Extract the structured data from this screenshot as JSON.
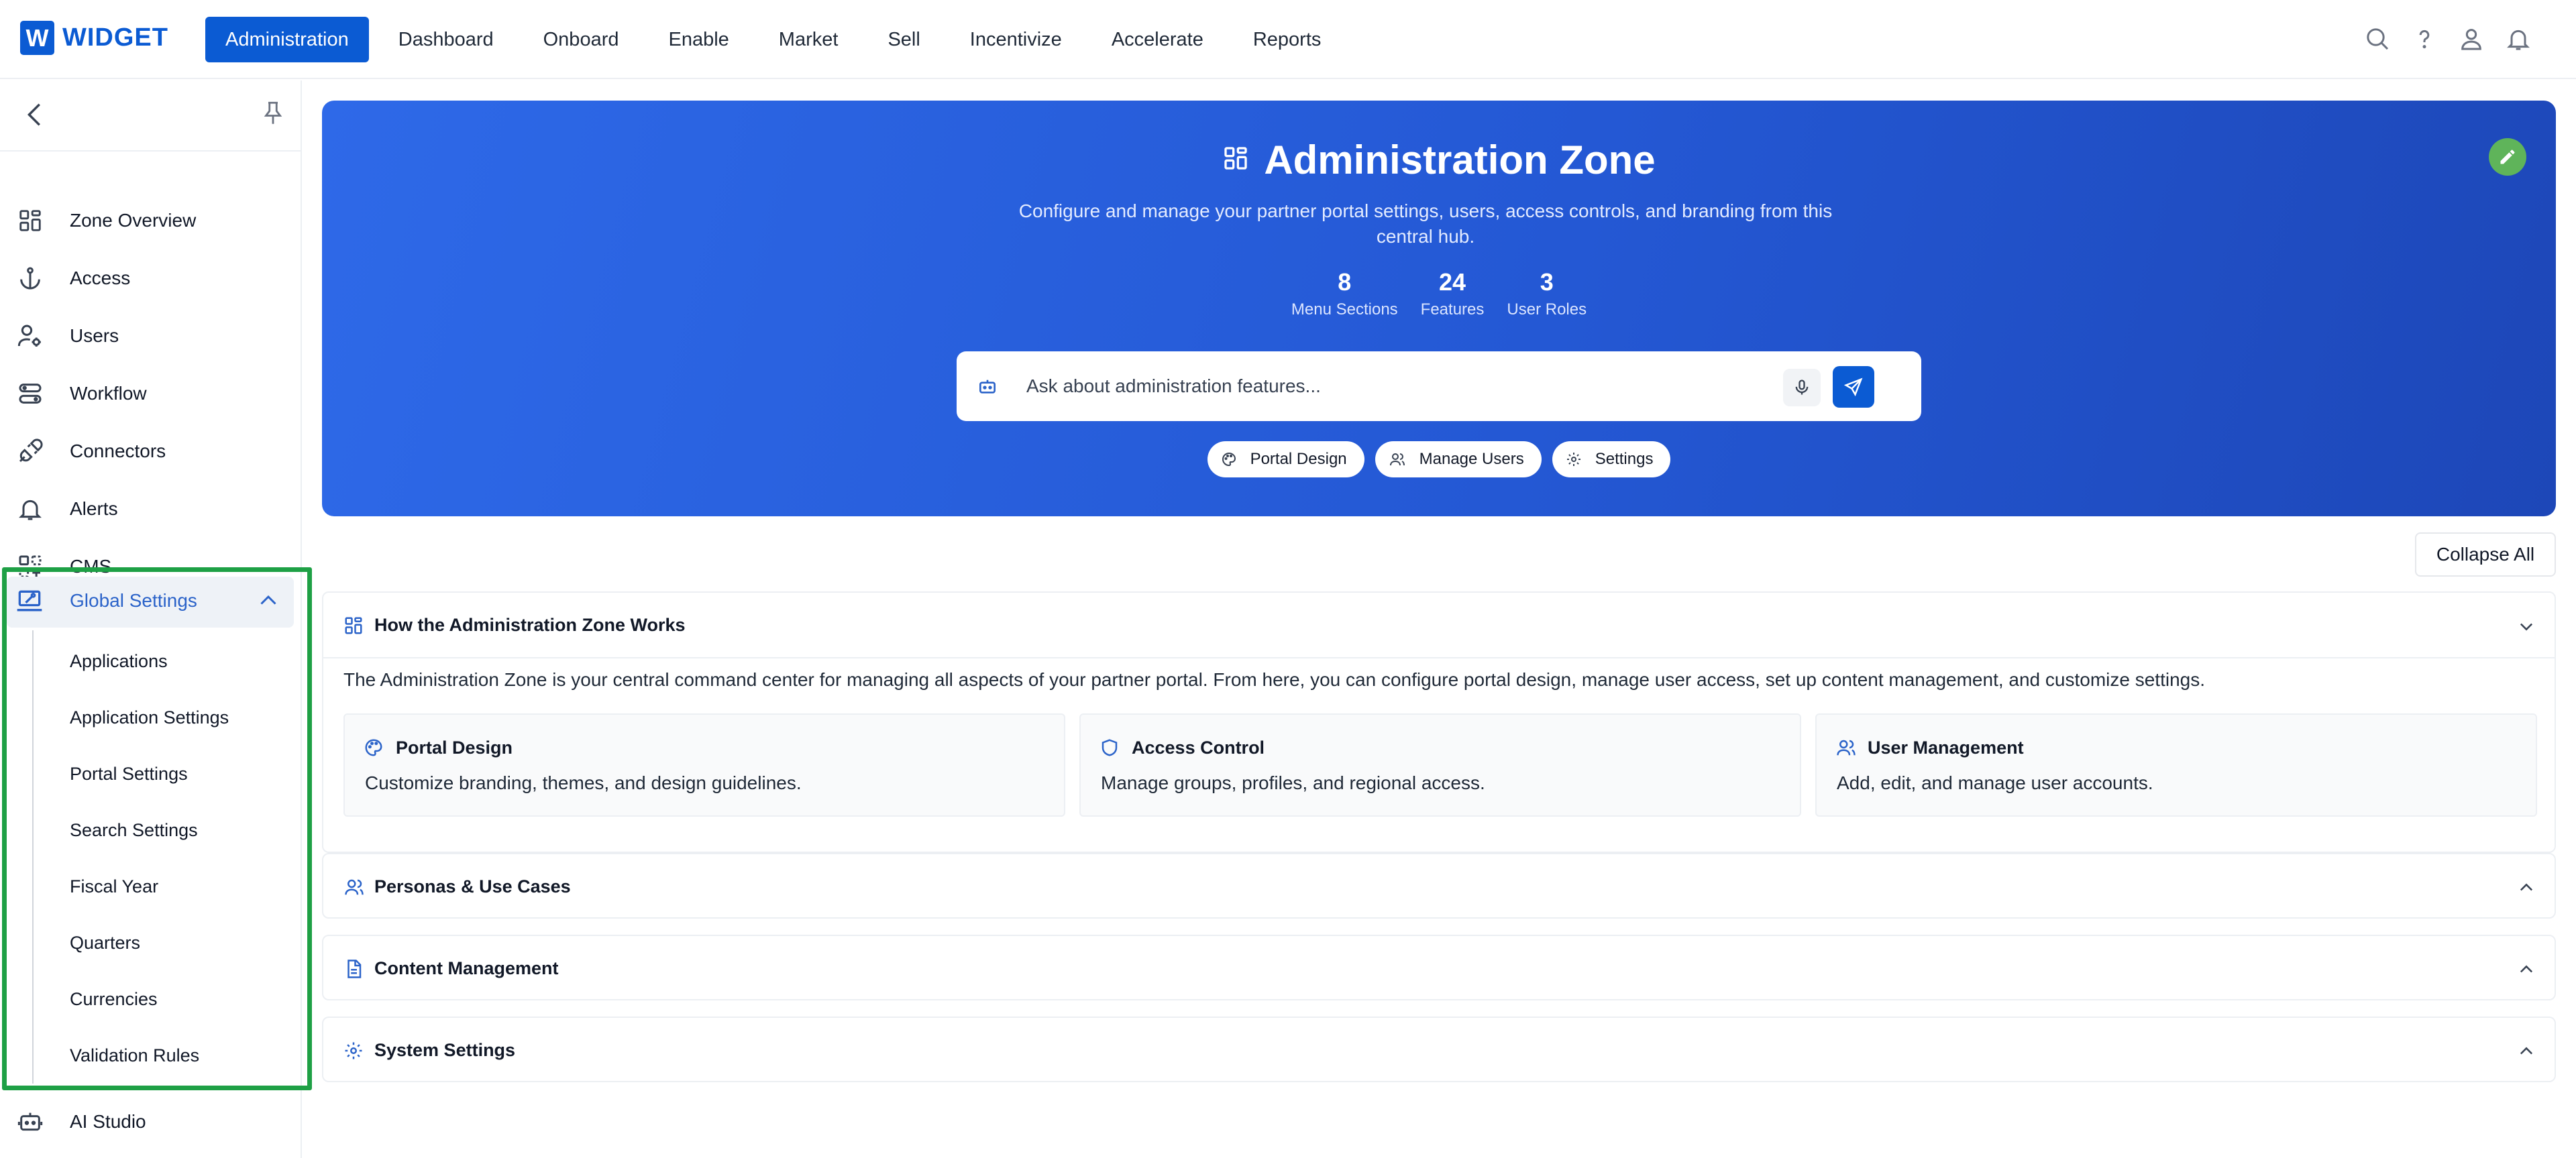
{
  "brand": {
    "logo_letter": "W",
    "name": "WIDGET",
    "accent": "#0b5bd3"
  },
  "topnav": {
    "items": [
      {
        "label": "Administration",
        "active": true
      },
      {
        "label": "Dashboard"
      },
      {
        "label": "Onboard"
      },
      {
        "label": "Enable"
      },
      {
        "label": "Market"
      },
      {
        "label": "Sell"
      },
      {
        "label": "Incentivize"
      },
      {
        "label": "Accelerate"
      },
      {
        "label": "Reports"
      }
    ],
    "icons": [
      "search-icon",
      "help-icon",
      "user-icon",
      "bell-icon"
    ]
  },
  "sidebar": {
    "items": [
      {
        "label": "Zone Overview",
        "icon": "grid-icon"
      },
      {
        "label": "Access",
        "icon": "anchor-icon"
      },
      {
        "label": "Users",
        "icon": "users-gear-icon"
      },
      {
        "label": "Workflow",
        "icon": "workflow-icon"
      },
      {
        "label": "Connectors",
        "icon": "plug-icon"
      },
      {
        "label": "Alerts",
        "icon": "bell-icon"
      },
      {
        "label": "CMS",
        "icon": "cms-icon"
      }
    ],
    "selected": {
      "label": "Global Settings",
      "icon": "laptop-settings-icon",
      "expanded": true
    },
    "sub_items": [
      "Applications",
      "Application Settings",
      "Portal Settings",
      "Search Settings",
      "Fiscal Year",
      "Quarters",
      "Currencies",
      "Validation Rules"
    ],
    "after": {
      "label": "AI Studio",
      "icon": "robot-icon"
    },
    "highlight_color": "#1ea045"
  },
  "hero": {
    "title": "Administration Zone",
    "description": "Configure and manage your partner portal settings, users, access controls, and branding from this central hub.",
    "stats": [
      {
        "value": "8",
        "label": "Menu Sections"
      },
      {
        "value": "24",
        "label": "Features"
      },
      {
        "value": "3",
        "label": "User Roles"
      }
    ],
    "search_placeholder": "Ask about administration features...",
    "chips": [
      {
        "label": "Portal Design",
        "icon": "palette-icon"
      },
      {
        "label": "Manage Users",
        "icon": "users-icon"
      },
      {
        "label": "Settings",
        "icon": "gear-icon"
      }
    ]
  },
  "collapse_all_label": "Collapse All",
  "sections": [
    {
      "title": "How the Administration Zone Works",
      "icon": "grid-icon",
      "expanded": true,
      "description": "The Administration Zone is your central command center for managing all aspects of your partner portal. From here, you can configure portal design, manage user access, set up content management, and customize settings.",
      "cards": [
        {
          "title": "Portal Design",
          "icon": "palette-icon",
          "desc": "Customize branding, themes, and design guidelines."
        },
        {
          "title": "Access Control",
          "icon": "shield-icon",
          "desc": "Manage groups, profiles, and regional access."
        },
        {
          "title": "User Management",
          "icon": "users-icon",
          "desc": "Add, edit, and manage user accounts."
        }
      ]
    },
    {
      "title": "Personas & Use Cases",
      "icon": "users-icon",
      "expanded": false
    },
    {
      "title": "Content Management",
      "icon": "document-icon",
      "expanded": false
    },
    {
      "title": "System Settings",
      "icon": "gear-icon",
      "expanded": false
    }
  ]
}
